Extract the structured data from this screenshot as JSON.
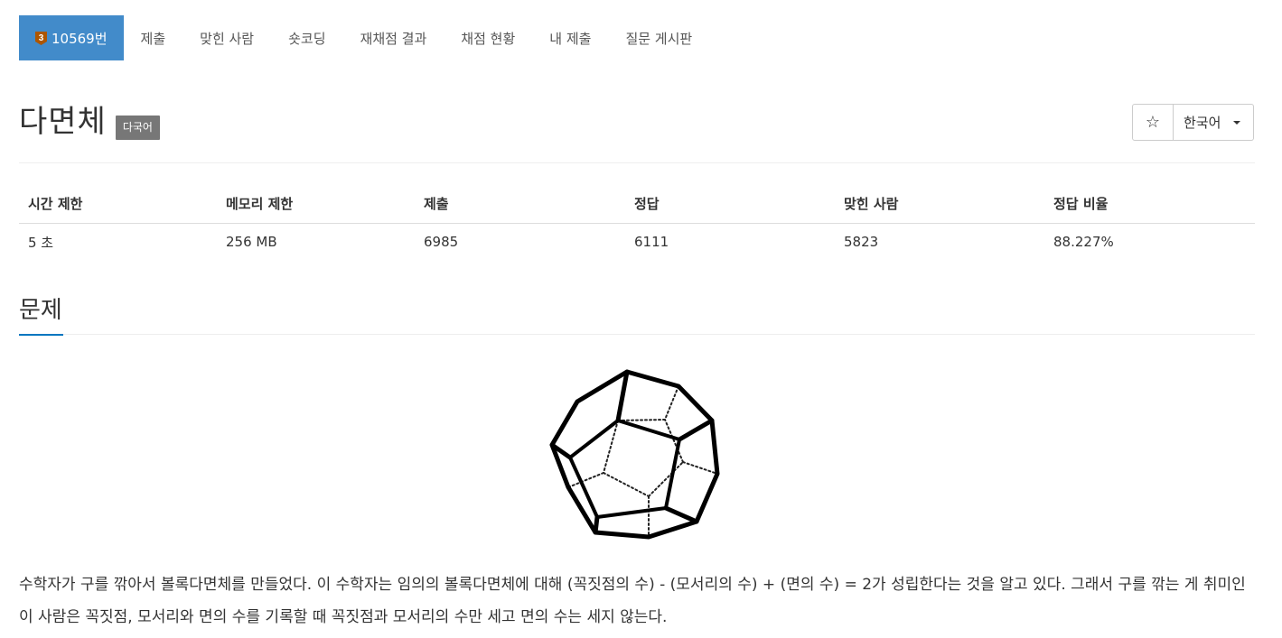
{
  "tabs": [
    {
      "label": "10569번",
      "active": true,
      "badge": "3",
      "badge_icon": "bronze-tier-3-icon",
      "badge_color": "#ad5600"
    },
    {
      "label": "제출"
    },
    {
      "label": "맞힌 사람"
    },
    {
      "label": "숏코딩"
    },
    {
      "label": "재채점 결과"
    },
    {
      "label": "채점 현황"
    },
    {
      "label": "내 제출"
    },
    {
      "label": "질문 게시판"
    }
  ],
  "title": "다면체",
  "language_badge": "다국어",
  "star_icon": "☆",
  "language_select": "한국어",
  "stats": {
    "headers": [
      "시간 제한",
      "메모리 제한",
      "제출",
      "정답",
      "맞힌 사람",
      "정답 비율"
    ],
    "values": [
      "5 초",
      "256 MB",
      "6985",
      "6111",
      "5823",
      "88.227%"
    ]
  },
  "section_title": "문제",
  "figure_icon": "dodecahedron-figure",
  "problem_text": "수학자가 구를 깎아서 볼록다면체를 만들었다. 이 수학자는 임의의 볼록다면체에 대해 (꼭짓점의 수) - (모서리의 수) + (면의 수) = 2가 성립한다는 것을 알고 있다. 그래서 구를 깎는 게 취미인 이 사람은 꼭짓점, 모서리와 면의 수를 기록할 때 꼭짓점과 모서리의 수만 세고 면의 수는 세지 않는다.",
  "colors": {
    "accent": "#428bca",
    "section_underline": "#0076c0",
    "badge_bg": "#777777"
  }
}
